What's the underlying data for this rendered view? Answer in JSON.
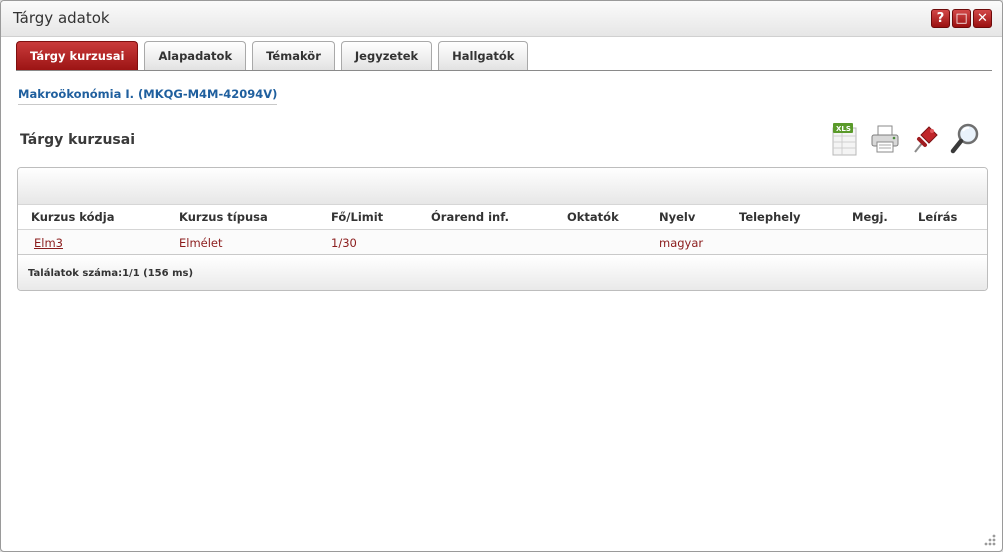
{
  "window": {
    "title": "Tárgy adatok"
  },
  "window_buttons": {
    "help": "?",
    "maximize": "□",
    "close": "✕"
  },
  "tabs": [
    {
      "label": "Tárgy kurzusai",
      "active": true
    },
    {
      "label": "Alapadatok",
      "active": false
    },
    {
      "label": "Témakör",
      "active": false
    },
    {
      "label": "Jegyzetek",
      "active": false
    },
    {
      "label": "Hallgatók",
      "active": false
    }
  ],
  "subject": {
    "link": "Makroökonómia I. (MKQG-M4M-42094V)"
  },
  "section": {
    "title": "Tárgy kurzusai"
  },
  "toolbar": {
    "icons": [
      "xls-export-icon",
      "print-icon",
      "pin-icon",
      "search-icon"
    ],
    "xls_label": "XLS"
  },
  "table": {
    "columns": [
      "Kurzus kódja",
      "Kurzus típusa",
      "Fő/Limit",
      "Órarend inf.",
      "Oktatók",
      "Nyelv",
      "Telephely",
      "Megj.",
      "Leírás"
    ],
    "rows": [
      {
        "code": "Elm3",
        "type": "Elmélet",
        "limit": "1/30",
        "schedule": "",
        "teachers": "",
        "language": "magyar",
        "site": "",
        "note": "",
        "desc": ""
      }
    ],
    "footer": "Találatok száma:1/1 (156 ms)"
  },
  "colors": {
    "accent": "#b02828",
    "link": "#1f5f9e",
    "row_text": "#8b1c1c"
  }
}
